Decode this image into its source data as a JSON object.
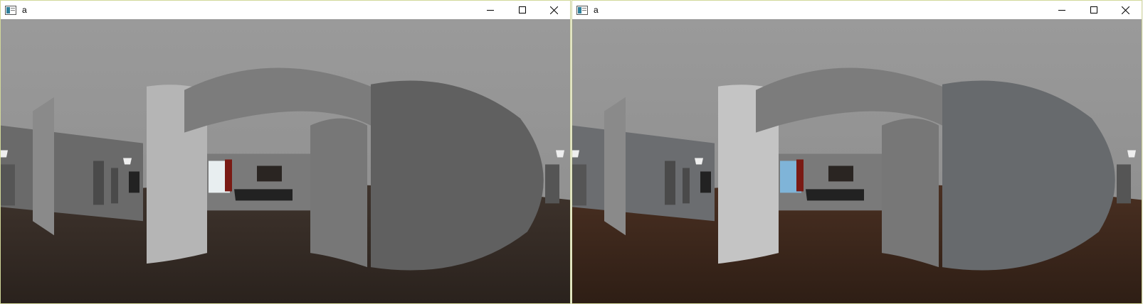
{
  "windows": [
    {
      "title": "a",
      "scene": {
        "floor_color": "#3f342d",
        "floor_dark": "#2a221d",
        "ceiling_color": "#8c8c8c",
        "wall_color": "#6a6a6a",
        "panel_color": "#606060",
        "pillar_color": "#b5b5b5",
        "window_light": "#e8eef0"
      }
    },
    {
      "title": "a",
      "scene": {
        "floor_color": "#4a3022",
        "floor_dark": "#2e1e15",
        "ceiling_color": "#8a8a8a",
        "wall_color": "#6b6d70",
        "panel_color": "#676a6d",
        "pillar_color": "#c4c4c4",
        "window_light": "#7fb4d8"
      }
    }
  ],
  "controls": {
    "minimize_icon": "minimize-icon",
    "maximize_icon": "maximize-icon",
    "close_icon": "close-icon"
  }
}
